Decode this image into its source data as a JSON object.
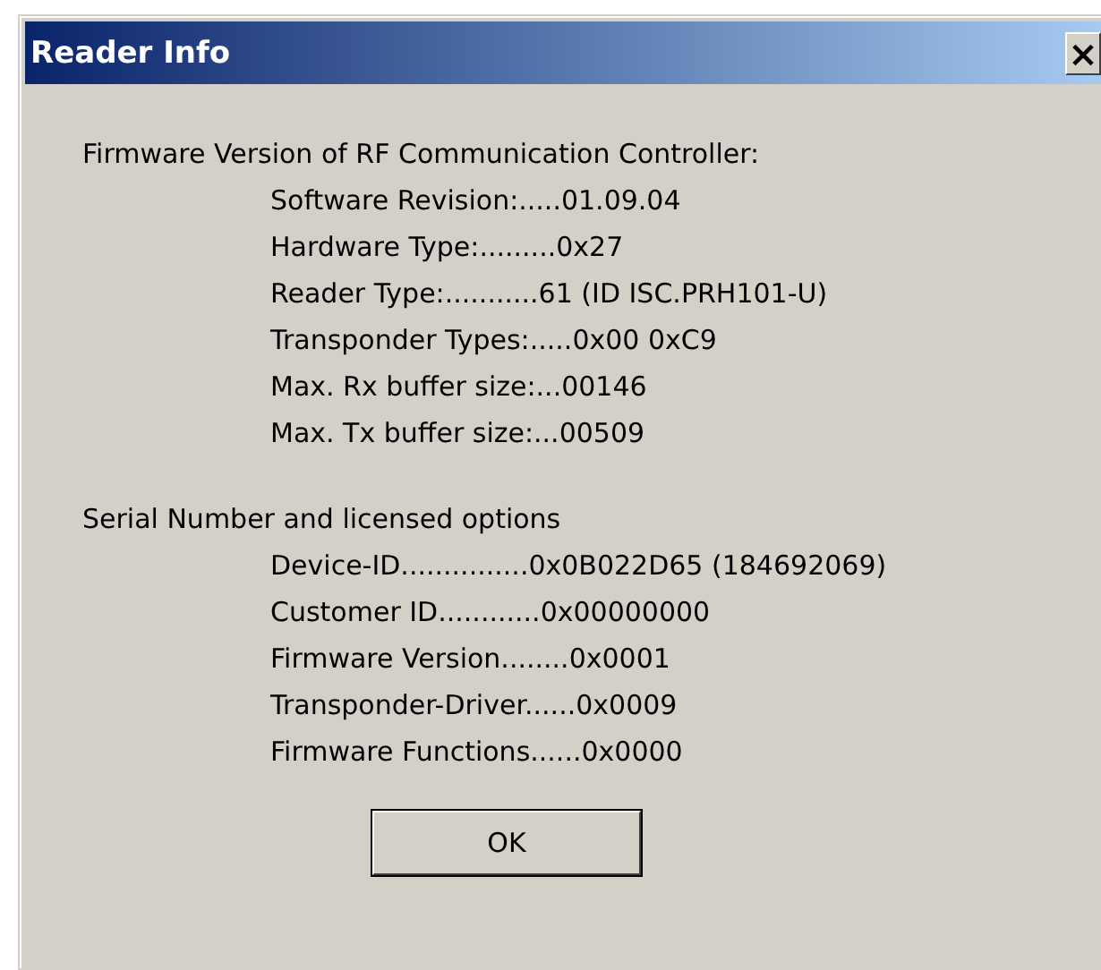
{
  "window": {
    "title": "Reader Info",
    "close": "×"
  },
  "sections": [
    {
      "heading": "Firmware Version of RF Communication Controller:",
      "lines": [
        "Software Revision:.....01.09.04",
        "Hardware Type:.........0x27",
        "Reader Type:...........61 (ID ISC.PRH101-U)",
        "Transponder Types:.....0x00 0xC9",
        "Max. Rx buffer size:...00146",
        "Max. Tx buffer size:...00509"
      ]
    },
    {
      "heading": "Serial Number and licensed options",
      "lines": [
        "Device-ID...............0x0B022D65 (184692069)",
        "Customer ID............0x00000000",
        "Firmware Version........0x0001",
        "Transponder-Driver......0x0009",
        "Firmware Functions......0x0000"
      ]
    }
  ],
  "buttons": [
    "OK"
  ]
}
